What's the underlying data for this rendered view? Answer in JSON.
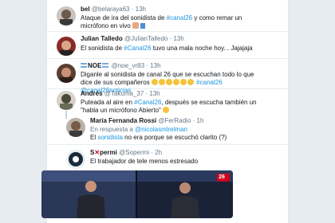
{
  "tweets": [
    {
      "name": "bel",
      "handle": "@belaraya63",
      "time": "13h",
      "text_a": "Ataque de ira del sonidista de ",
      "hashtag": "#canal26",
      "text_b": "  y como remar un micrófono en vivo "
    },
    {
      "name": "Julian Talledo",
      "handle": "@JulianTalledo",
      "time": "13h",
      "text_a": "El sonidista de ",
      "hashtag": "#Canal26",
      "text_b": " tuvo una mala noche hoy... Jajajaja"
    },
    {
      "name": "NOE",
      "handle": "@noe_vr83",
      "time": "13h",
      "text_a": "Diganle al sonidista de canal 26 que se escuchan todo lo que dice de sus compañeros ",
      "hashtag": "#canal26",
      "hashtag2": "@canal26noticias"
    },
    {
      "name": "Andrés",
      "handle": "@Takuma_37",
      "time": "13h",
      "text_a": "Puteada al aire en ",
      "hashtag": "#Canal26",
      "text_b": ", después se escucha también un \"habla un micrófono Abierto\" "
    },
    {
      "name": "María Fernanda Rossi",
      "handle": "@FerRadio",
      "time": "1h",
      "reply_prefix": "En respuesta a ",
      "reply_to": "@nicolasmlrelman",
      "text_a": "El ",
      "hashtag": "sonidista",
      "text_b": " no era porque se escuchó clarito (?)"
    },
    {
      "name": "S",
      "name_b": "permi",
      "handle": "@Sopermi",
      "time": "2h",
      "text_a": "El trabajador de tele menos estresado"
    }
  ],
  "media": {
    "channel_logo": "26"
  },
  "colors": {
    "link": "#1b95e0",
    "muted": "#657786",
    "text": "#14171a",
    "border": "#e6ecf0"
  }
}
